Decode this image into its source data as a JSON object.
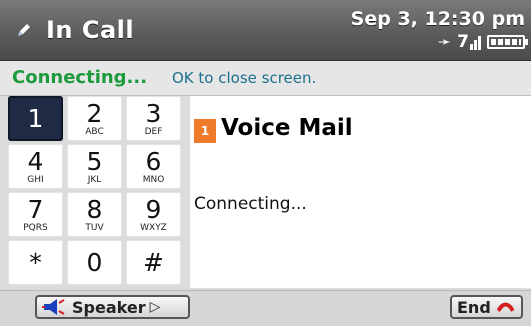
{
  "title_bar": {
    "title": "In Call",
    "datetime": "Sep 3, 12:30 pm",
    "icon": "pencil-icon",
    "status_icons": [
      "bluetooth-icon",
      "signal-icon",
      "battery-icon"
    ],
    "signal_label": "7"
  },
  "status": {
    "strong": "Connecting...",
    "rest": "OK to close screen."
  },
  "keypad": {
    "keys": [
      {
        "num": "1",
        "letters": ""
      },
      {
        "num": "2",
        "letters": "ABC"
      },
      {
        "num": "3",
        "letters": "DEF"
      },
      {
        "num": "4",
        "letters": "GHI"
      },
      {
        "num": "5",
        "letters": "JKL"
      },
      {
        "num": "6",
        "letters": "MNO"
      },
      {
        "num": "7",
        "letters": "PQRS"
      },
      {
        "num": "8",
        "letters": "TUV"
      },
      {
        "num": "9",
        "letters": "WXYZ"
      },
      {
        "num": "*",
        "letters": ""
      },
      {
        "num": "0",
        "letters": ""
      },
      {
        "num": "#",
        "letters": ""
      }
    ],
    "selected": "1"
  },
  "panel": {
    "badge": "1",
    "title": "Voice Mail",
    "status": "Connecting..."
  },
  "bottom": {
    "speaker_label": "Speaker",
    "end_label": "End"
  },
  "colors": {
    "accent_green": "#1c9a3c",
    "badge_orange": "#ef7a2b",
    "selected_key": "#1f2b44",
    "end_red": "#d42020"
  }
}
